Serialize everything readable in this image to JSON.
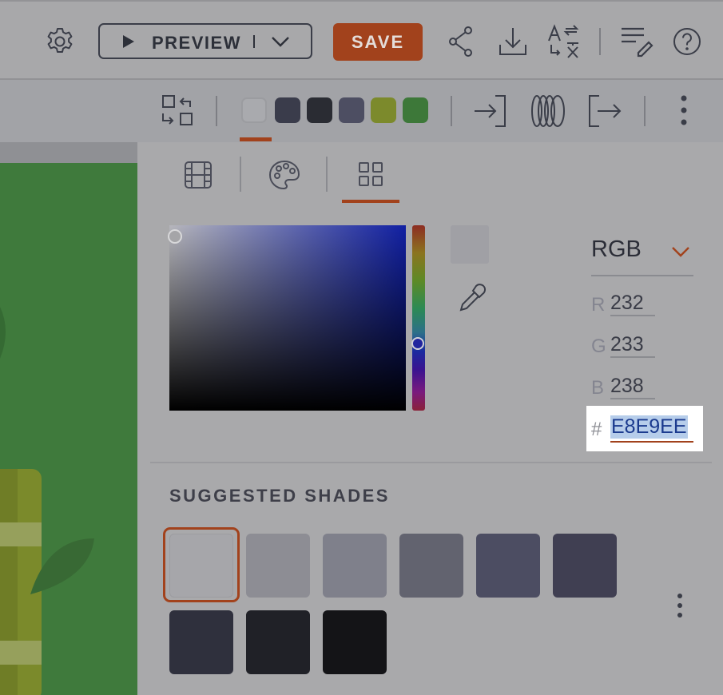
{
  "header": {
    "settings_icon": "gear-icon",
    "preview_label": "PREVIEW",
    "save_label": "SAVE",
    "action_icons": [
      "share-icon",
      "download-icon",
      "translate-icon",
      "edit-list-icon",
      "help-icon"
    ]
  },
  "toolbar": {
    "icons": [
      "layout-swap-icon",
      "import-icon",
      "layers-icon",
      "export-icon",
      "more-vertical-icon"
    ],
    "swatches": [
      "#a9aaae",
      "#3a3c4b",
      "#2a2c33",
      "#4d4e62",
      "#7c8a2c",
      "#3d7839"
    ],
    "active_swatch_index": 0
  },
  "panel": {
    "tabs": [
      {
        "icon": "film-grid-icon"
      },
      {
        "icon": "palette-icon"
      },
      {
        "icon": "grid-icon"
      }
    ],
    "active_tab_index": 2,
    "picker": {
      "mode": "RGB",
      "channels": [
        {
          "label": "R",
          "value": "232"
        },
        {
          "label": "G",
          "value": "233"
        },
        {
          "label": "B",
          "value": "238"
        }
      ],
      "hex_prefix": "#",
      "hex_value": "E8E9EE",
      "preview_color": "#a0a0a5"
    },
    "suggested_shades": {
      "title": "SUGGESTED SHADES",
      "shades": [
        "#a6a6aa",
        "#8d8d94",
        "#7f808b",
        "#62636f",
        "#4c4d62",
        "#403f52",
        "#2f303d",
        "#202127",
        "#141417"
      ],
      "selected_index": 0
    }
  },
  "colors": {
    "accent": "#a2421c",
    "canvas_green": "#3f7a3c"
  }
}
